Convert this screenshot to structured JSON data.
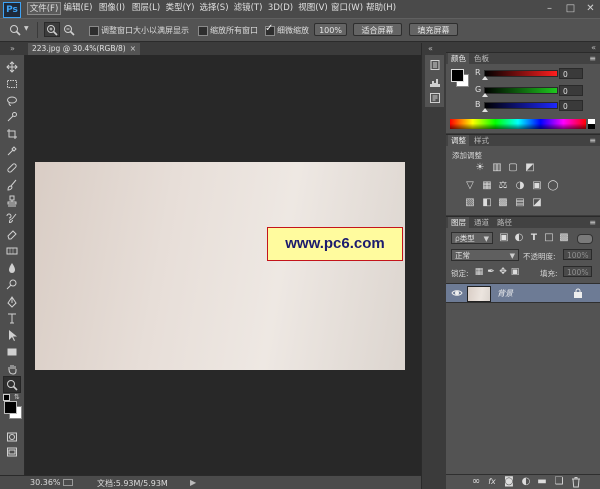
{
  "app": {
    "logo": "Ps",
    "accent": "#3ea3f5"
  },
  "menu": {
    "items": [
      "文件(F)",
      "编辑(E)",
      "图像(I)",
      "图层(L)",
      "类型(Y)",
      "选择(S)",
      "滤镜(T)",
      "3D(D)",
      "视图(V)",
      "窗口(W)",
      "帮助(H)"
    ]
  },
  "options_bar": {
    "resize_windows": {
      "label": "调整窗口大小以满屏显示",
      "checked": false
    },
    "zoom_all": {
      "label": "缩放所有窗口",
      "checked": false
    },
    "scrubby_zoom": {
      "label": "细微缩放",
      "checked": true
    },
    "actual_pixels_button": "100%",
    "fit_screen_button": "适合屏幕",
    "fill_screen_button": "填充屏幕"
  },
  "document": {
    "tab_title": "223.jpg @ 30.4%(RGB/8)",
    "watermark": "www.pc6.com",
    "status_zoom": "30.36%",
    "status_doc_size": "文档:5.93M/5.93M"
  },
  "color_panel": {
    "tabs": [
      "颜色",
      "色板"
    ],
    "foreground": "#000000",
    "background": "#ffffff",
    "channels": [
      {
        "label": "R",
        "value": "0",
        "color": "#ff1e1e"
      },
      {
        "label": "G",
        "value": "0",
        "color": "#1ec81e"
      },
      {
        "label": "B",
        "value": "0",
        "color": "#1e28ff"
      }
    ]
  },
  "adjustments_panel": {
    "tabs": [
      "调整",
      "样式"
    ],
    "heading": "添加调整"
  },
  "layers_panel": {
    "tabs": [
      "图层",
      "通道",
      "路径"
    ],
    "filter_kind": "类型",
    "blend_mode": "正常",
    "opacity_label": "不透明度:",
    "opacity_value": "100%",
    "lock_label": "锁定:",
    "fill_label": "填充:",
    "fill_value": "100%",
    "layers": [
      {
        "name": "背景",
        "visible": true,
        "locked": true,
        "selected": true
      }
    ],
    "selected_color": "#6d7b95"
  }
}
